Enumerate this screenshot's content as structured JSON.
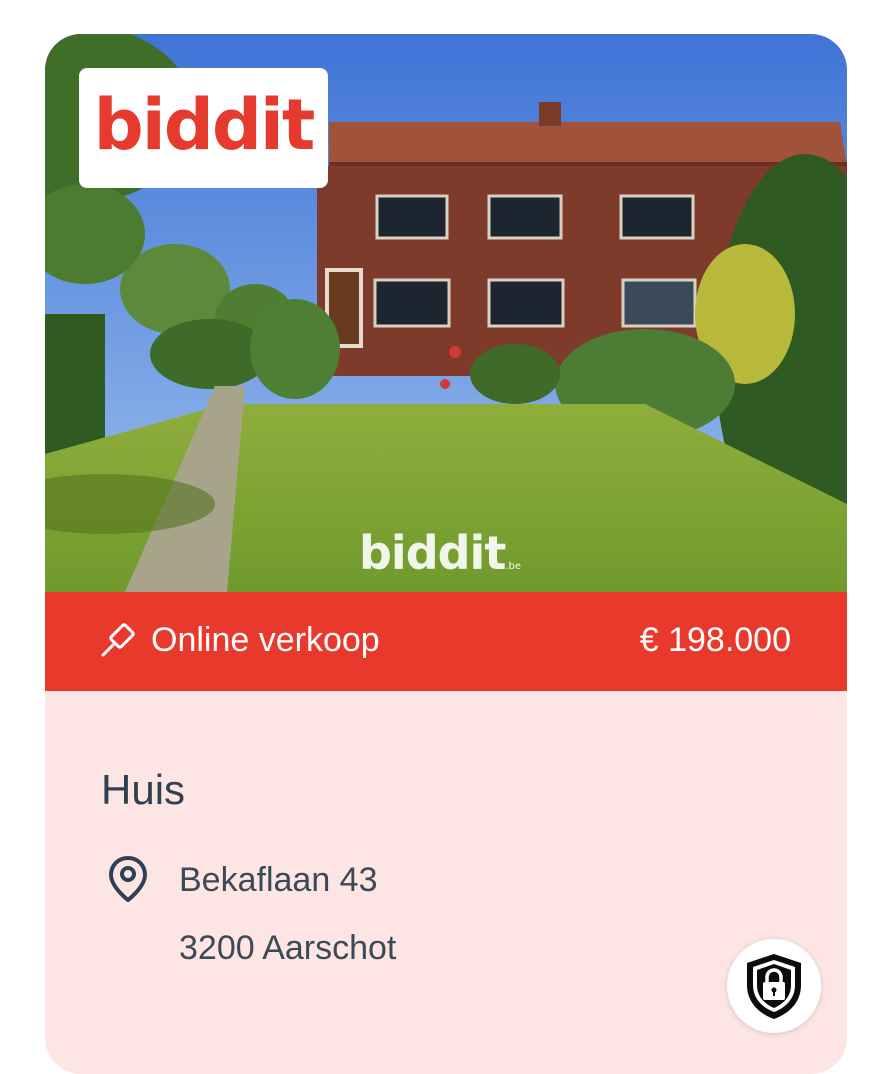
{
  "listing": {
    "brand_logo": "biddit",
    "watermark": "biddit",
    "watermark_suffix": ".be",
    "sale_type": "Online verkoop",
    "price": "€ 198.000",
    "property_type": "Huis",
    "address_line1": "Bekaflaan 43",
    "address_line2": "3200 Aarschot",
    "photo_description_icon": "house-photo"
  },
  "icons": {
    "sale_type": "gavel-icon",
    "location": "map-pin-icon",
    "security": "lock-shield-icon"
  },
  "colors": {
    "brand_red": "#e9392c",
    "info_background": "#fde5e4",
    "title_text": "#2f4150"
  }
}
